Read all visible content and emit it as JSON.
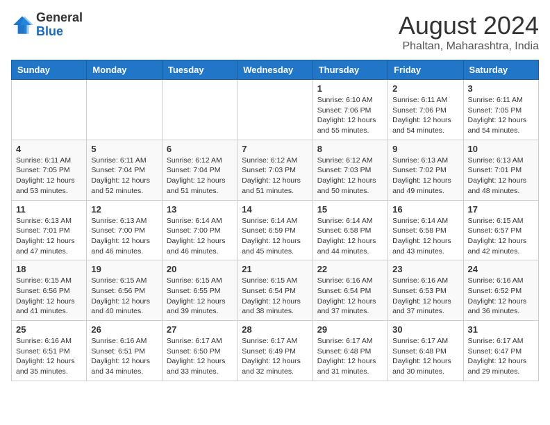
{
  "header": {
    "logo_general": "General",
    "logo_blue": "Blue",
    "month_title": "August 2024",
    "location": "Phaltan, Maharashtra, India"
  },
  "days_of_week": [
    "Sunday",
    "Monday",
    "Tuesday",
    "Wednesday",
    "Thursday",
    "Friday",
    "Saturday"
  ],
  "weeks": [
    [
      {
        "day": "",
        "info": ""
      },
      {
        "day": "",
        "info": ""
      },
      {
        "day": "",
        "info": ""
      },
      {
        "day": "",
        "info": ""
      },
      {
        "day": "1",
        "info": "Sunrise: 6:10 AM\nSunset: 7:06 PM\nDaylight: 12 hours\nand 55 minutes."
      },
      {
        "day": "2",
        "info": "Sunrise: 6:11 AM\nSunset: 7:06 PM\nDaylight: 12 hours\nand 54 minutes."
      },
      {
        "day": "3",
        "info": "Sunrise: 6:11 AM\nSunset: 7:05 PM\nDaylight: 12 hours\nand 54 minutes."
      }
    ],
    [
      {
        "day": "4",
        "info": "Sunrise: 6:11 AM\nSunset: 7:05 PM\nDaylight: 12 hours\nand 53 minutes."
      },
      {
        "day": "5",
        "info": "Sunrise: 6:11 AM\nSunset: 7:04 PM\nDaylight: 12 hours\nand 52 minutes."
      },
      {
        "day": "6",
        "info": "Sunrise: 6:12 AM\nSunset: 7:04 PM\nDaylight: 12 hours\nand 51 minutes."
      },
      {
        "day": "7",
        "info": "Sunrise: 6:12 AM\nSunset: 7:03 PM\nDaylight: 12 hours\nand 51 minutes."
      },
      {
        "day": "8",
        "info": "Sunrise: 6:12 AM\nSunset: 7:03 PM\nDaylight: 12 hours\nand 50 minutes."
      },
      {
        "day": "9",
        "info": "Sunrise: 6:13 AM\nSunset: 7:02 PM\nDaylight: 12 hours\nand 49 minutes."
      },
      {
        "day": "10",
        "info": "Sunrise: 6:13 AM\nSunset: 7:01 PM\nDaylight: 12 hours\nand 48 minutes."
      }
    ],
    [
      {
        "day": "11",
        "info": "Sunrise: 6:13 AM\nSunset: 7:01 PM\nDaylight: 12 hours\nand 47 minutes."
      },
      {
        "day": "12",
        "info": "Sunrise: 6:13 AM\nSunset: 7:00 PM\nDaylight: 12 hours\nand 46 minutes."
      },
      {
        "day": "13",
        "info": "Sunrise: 6:14 AM\nSunset: 7:00 PM\nDaylight: 12 hours\nand 46 minutes."
      },
      {
        "day": "14",
        "info": "Sunrise: 6:14 AM\nSunset: 6:59 PM\nDaylight: 12 hours\nand 45 minutes."
      },
      {
        "day": "15",
        "info": "Sunrise: 6:14 AM\nSunset: 6:58 PM\nDaylight: 12 hours\nand 44 minutes."
      },
      {
        "day": "16",
        "info": "Sunrise: 6:14 AM\nSunset: 6:58 PM\nDaylight: 12 hours\nand 43 minutes."
      },
      {
        "day": "17",
        "info": "Sunrise: 6:15 AM\nSunset: 6:57 PM\nDaylight: 12 hours\nand 42 minutes."
      }
    ],
    [
      {
        "day": "18",
        "info": "Sunrise: 6:15 AM\nSunset: 6:56 PM\nDaylight: 12 hours\nand 41 minutes."
      },
      {
        "day": "19",
        "info": "Sunrise: 6:15 AM\nSunset: 6:56 PM\nDaylight: 12 hours\nand 40 minutes."
      },
      {
        "day": "20",
        "info": "Sunrise: 6:15 AM\nSunset: 6:55 PM\nDaylight: 12 hours\nand 39 minutes."
      },
      {
        "day": "21",
        "info": "Sunrise: 6:15 AM\nSunset: 6:54 PM\nDaylight: 12 hours\nand 38 minutes."
      },
      {
        "day": "22",
        "info": "Sunrise: 6:16 AM\nSunset: 6:54 PM\nDaylight: 12 hours\nand 37 minutes."
      },
      {
        "day": "23",
        "info": "Sunrise: 6:16 AM\nSunset: 6:53 PM\nDaylight: 12 hours\nand 37 minutes."
      },
      {
        "day": "24",
        "info": "Sunrise: 6:16 AM\nSunset: 6:52 PM\nDaylight: 12 hours\nand 36 minutes."
      }
    ],
    [
      {
        "day": "25",
        "info": "Sunrise: 6:16 AM\nSunset: 6:51 PM\nDaylight: 12 hours\nand 35 minutes."
      },
      {
        "day": "26",
        "info": "Sunrise: 6:16 AM\nSunset: 6:51 PM\nDaylight: 12 hours\nand 34 minutes."
      },
      {
        "day": "27",
        "info": "Sunrise: 6:17 AM\nSunset: 6:50 PM\nDaylight: 12 hours\nand 33 minutes."
      },
      {
        "day": "28",
        "info": "Sunrise: 6:17 AM\nSunset: 6:49 PM\nDaylight: 12 hours\nand 32 minutes."
      },
      {
        "day": "29",
        "info": "Sunrise: 6:17 AM\nSunset: 6:48 PM\nDaylight: 12 hours\nand 31 minutes."
      },
      {
        "day": "30",
        "info": "Sunrise: 6:17 AM\nSunset: 6:48 PM\nDaylight: 12 hours\nand 30 minutes."
      },
      {
        "day": "31",
        "info": "Sunrise: 6:17 AM\nSunset: 6:47 PM\nDaylight: 12 hours\nand 29 minutes."
      }
    ]
  ]
}
